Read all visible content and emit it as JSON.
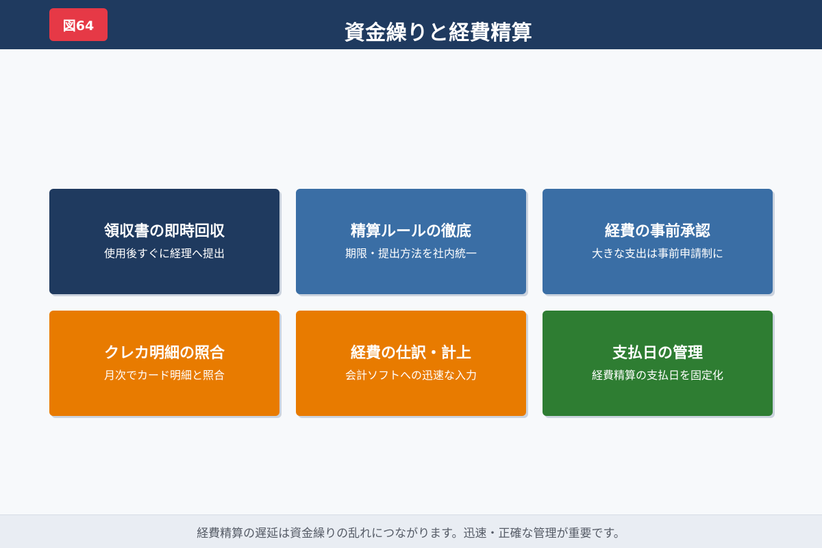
{
  "header": {
    "badge": "図64",
    "title": "資金繰りと経費精算"
  },
  "cards": [
    {
      "title": "領収書の即時回収",
      "subtitle": "使用後すぐに経理へ提出",
      "color": "#1f3a5f"
    },
    {
      "title": "精算ルールの徹底",
      "subtitle": "期限・提出方法を社内統一",
      "color": "#3a6ea5"
    },
    {
      "title": "経費の事前承認",
      "subtitle": "大きな支出は事前申請制に",
      "color": "#3a6ea5"
    },
    {
      "title": "クレカ明細の照合",
      "subtitle": "月次でカード明細と照合",
      "color": "#e87b00"
    },
    {
      "title": "経費の仕訳・計上",
      "subtitle": "会計ソフトへの迅速な入力",
      "color": "#e87b00"
    },
    {
      "title": "支払日の管理",
      "subtitle": "経費精算の支払日を固定化",
      "color": "#2e7d32"
    }
  ],
  "footer": {
    "text": "経費精算の遅延は資金繰りの乱れにつながります。迅速・正確な管理が重要です。"
  }
}
